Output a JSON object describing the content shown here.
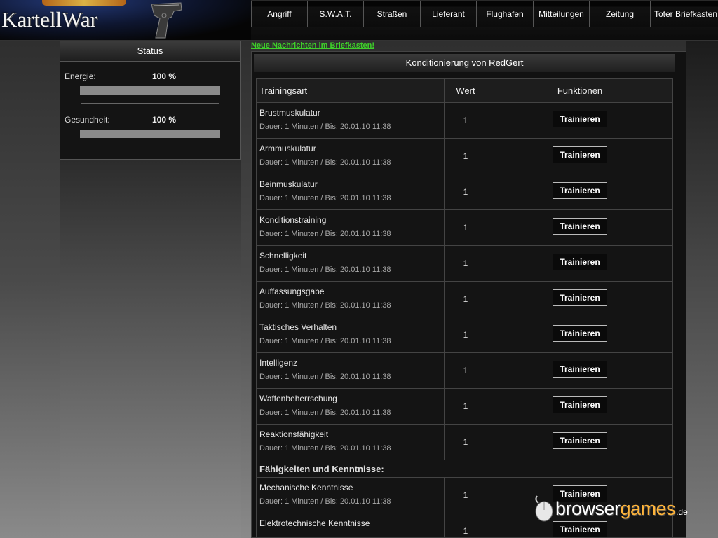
{
  "logo": {
    "text": "KartellWar"
  },
  "nav": {
    "items": [
      {
        "label": "Angriff",
        "width": 80
      },
      {
        "label": "S.W.A.T.",
        "width": 80
      },
      {
        "label": "Straßen",
        "width": 81
      },
      {
        "label": "Lieferant",
        "width": 80
      },
      {
        "label": "Flughafen",
        "width": 81
      },
      {
        "label": "Mitteilungen",
        "width": 80
      },
      {
        "label": "Zeitung",
        "width": 87
      },
      {
        "label": "Toter Briefkasten",
        "width": 101
      }
    ]
  },
  "status": {
    "title": "Status",
    "energie": {
      "label": "Energie:",
      "value": "100 %",
      "percent": 100
    },
    "gesundheit": {
      "label": "Gesundheit:",
      "value": "100 %",
      "percent": 100
    }
  },
  "messages": {
    "link": "Neue Nachrichten im Briefkasten!"
  },
  "main": {
    "title": "Konditionierung von RedGert",
    "columns": {
      "art": "Trainingsart",
      "wert": "Wert",
      "funktionen": "Funktionen"
    },
    "button_label": "Trainieren",
    "rows": [
      {
        "name": "Brustmuskulatur",
        "dauer": "Dauer: 1 Minuten / Bis: 20.01.10 11:38",
        "wert": "1"
      },
      {
        "name": "Armmuskulatur",
        "dauer": "Dauer: 1 Minuten / Bis: 20.01.10 11:38",
        "wert": "1"
      },
      {
        "name": "Beinmuskulatur",
        "dauer": "Dauer: 1 Minuten / Bis: 20.01.10 11:38",
        "wert": "1"
      },
      {
        "name": "Konditionstraining",
        "dauer": "Dauer: 1 Minuten / Bis: 20.01.10 11:38",
        "wert": "1"
      },
      {
        "name": "Schnelligkeit",
        "dauer": "Dauer: 1 Minuten / Bis: 20.01.10 11:38",
        "wert": "1"
      },
      {
        "name": "Auffassungsgabe",
        "dauer": "Dauer: 1 Minuten / Bis: 20.01.10 11:38",
        "wert": "1"
      },
      {
        "name": "Taktisches Verhalten",
        "dauer": "Dauer: 1 Minuten / Bis: 20.01.10 11:38",
        "wert": "1"
      },
      {
        "name": "Intelligenz",
        "dauer": "Dauer: 1 Minuten / Bis: 20.01.10 11:38",
        "wert": "1"
      },
      {
        "name": "Waffenbeherrschung",
        "dauer": "Dauer: 1 Minuten / Bis: 20.01.10 11:38",
        "wert": "1"
      },
      {
        "name": "Reaktionsfähigkeit",
        "dauer": "Dauer: 1 Minuten / Bis: 20.01.10 11:38",
        "wert": "1"
      }
    ],
    "section2_title": "Fähigkeiten und Kenntnisse:",
    "rows2": [
      {
        "name": "Mechanische Kenntnisse",
        "dauer": "Dauer: 1 Minuten / Bis: 20.01.10 11:38",
        "wert": "1"
      },
      {
        "name": "Elektrotechnische Kenntnisse",
        "dauer": "",
        "wert": "1"
      }
    ]
  },
  "watermark": {
    "part1": "browser",
    "part2": "games",
    "tld": ".de"
  },
  "colors": {
    "link_green": "#3ecf2a",
    "watermark_orange": "#ffb43a"
  }
}
